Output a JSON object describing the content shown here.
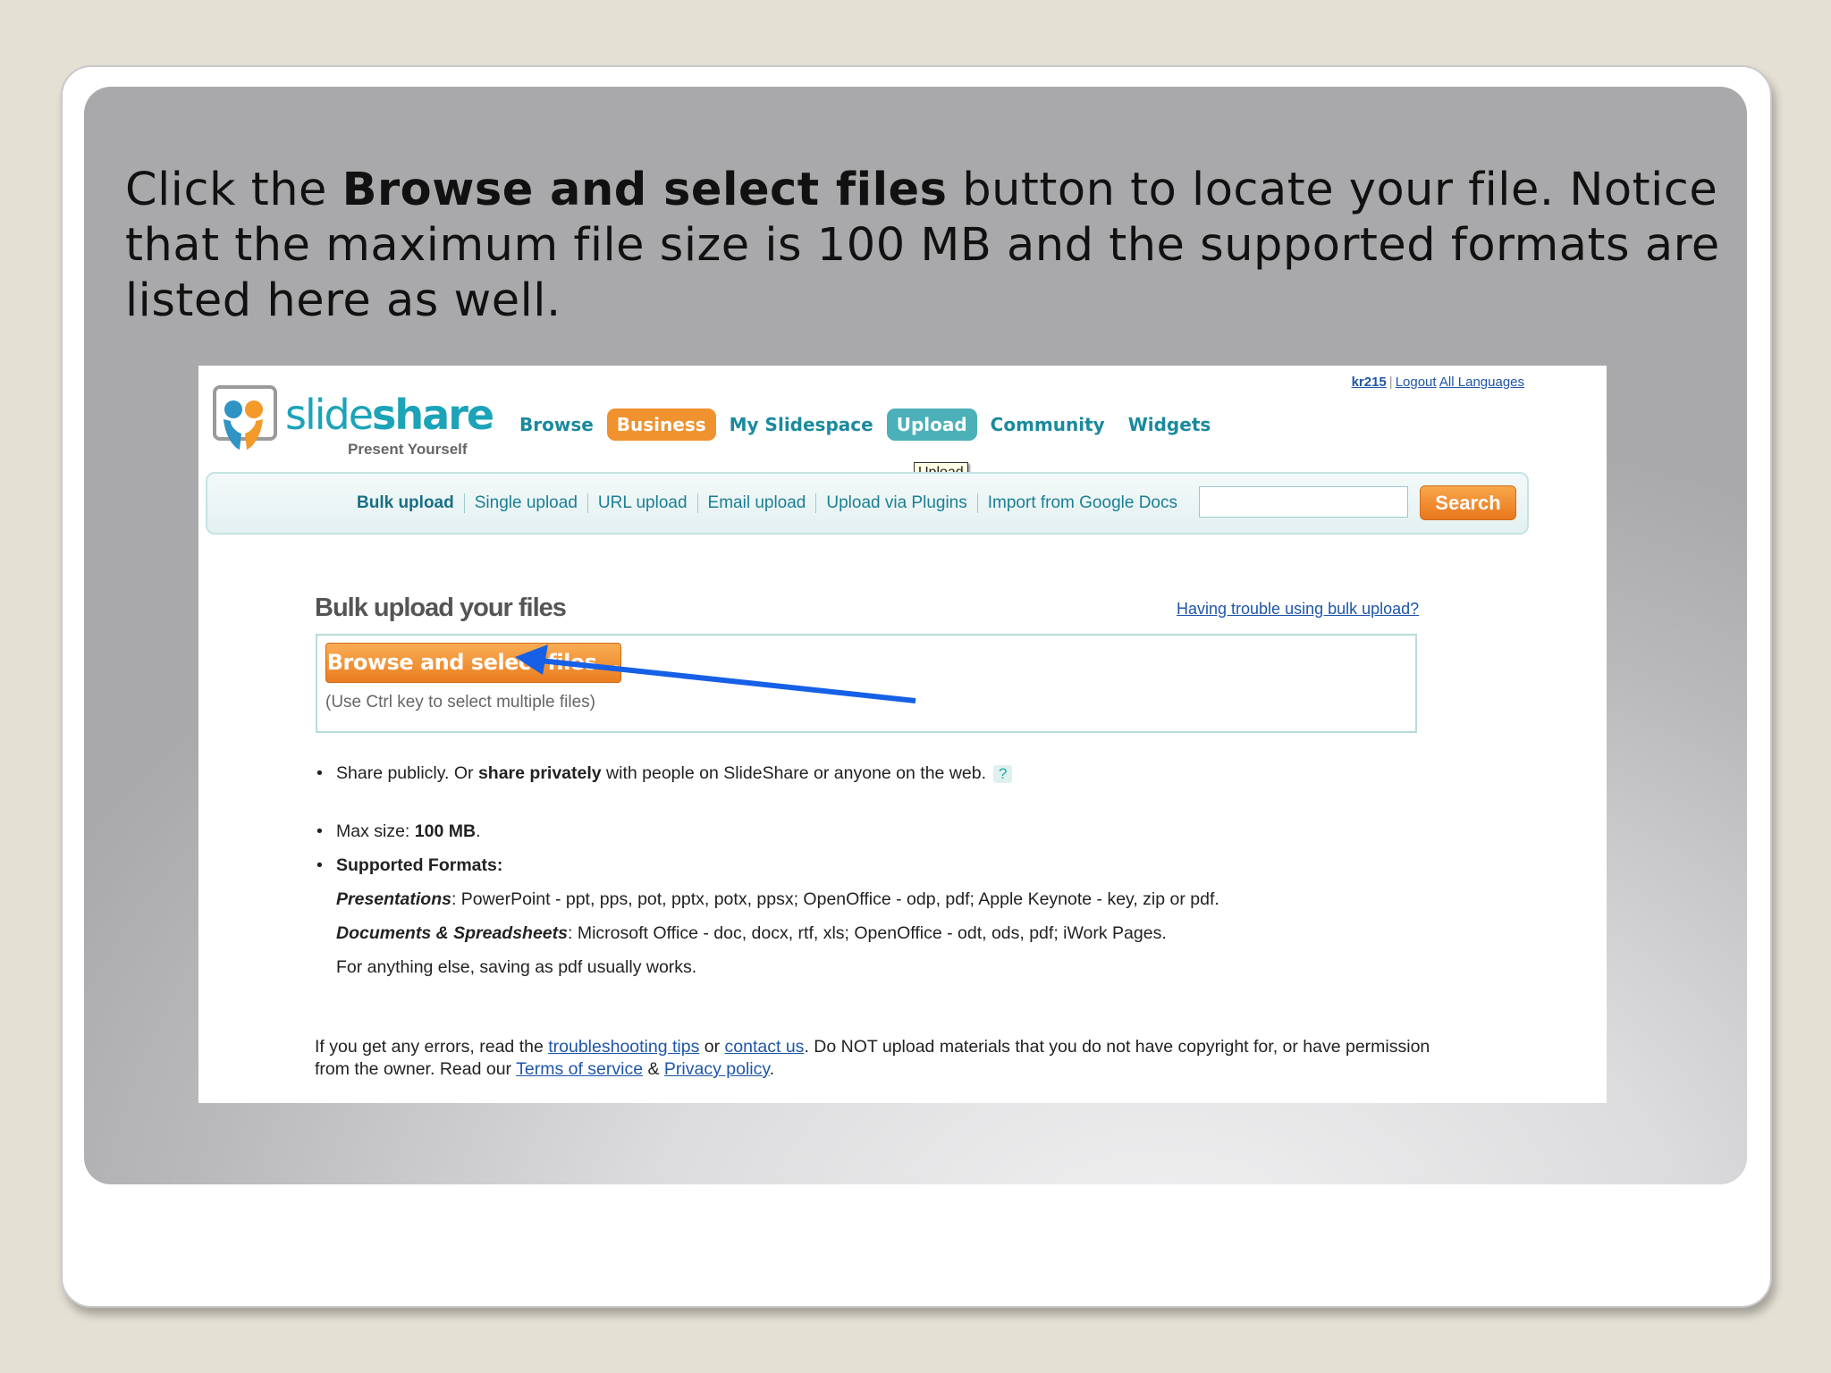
{
  "caption": {
    "part1": "Click the ",
    "bold": "Browse and select files",
    "part2": " button to locate your file. Notice that the maximum file size is 100 MB and the supported formats are listed here as well."
  },
  "logo": {
    "name_light": "slide",
    "name_bold": "share",
    "tagline": "Present Yourself"
  },
  "user_links": {
    "user": "kr215",
    "logout": "Logout",
    "languages": "All Languages"
  },
  "main_nav": [
    "Browse",
    "Business",
    "My Slidespace",
    "Upload",
    "Community",
    "Widgets"
  ],
  "tooltip": "Upload",
  "sub_nav": [
    "Bulk upload",
    "Single upload",
    "URL upload",
    "Email upload",
    "Upload via Plugins",
    "Import from Google Docs"
  ],
  "search": {
    "value": "",
    "button": "Search"
  },
  "section": {
    "title": "Bulk upload your files",
    "trouble_link": "Having trouble using bulk upload?"
  },
  "upload_box": {
    "button": "Browse and select files...",
    "hint": "(Use Ctrl key to select multiple files)"
  },
  "share": {
    "prefix": "Share publicly. Or ",
    "bold": "share privately",
    "suffix": " with people on SlideShare or anyone on the web.",
    "help": "?"
  },
  "max_size": {
    "label": "Max size: ",
    "value": "100 MB",
    "tail": "."
  },
  "formats": {
    "heading": "Supported Formats:",
    "presentations_label": "Presentations",
    "presentations_text": ": PowerPoint - ppt, pps, pot, pptx, potx, ppsx; OpenOffice - odp, pdf; Apple Keynote - key, zip or pdf.",
    "documents_label": "Documents & Spreadsheets",
    "documents_text": ": Microsoft Office - doc, docx, rtf, xls; OpenOffice - odt, ods, pdf; iWork Pages.",
    "other": "For anything else, saving as pdf usually works."
  },
  "footer": {
    "t1": "If you get any errors, read the ",
    "troubleshooting": "troubleshooting tips",
    "t2": " or ",
    "contact": "contact us",
    "t3": ". Do NOT upload materials that you do not have copyright for, or have permission from the owner. Read our ",
    "terms": "Terms of service",
    "t4": " & ",
    "privacy": "Privacy policy",
    "t5": "."
  },
  "colors": {
    "accent_orange": "#f0922e",
    "accent_teal": "#4bb0b8",
    "arrow_blue": "#1560e6"
  }
}
